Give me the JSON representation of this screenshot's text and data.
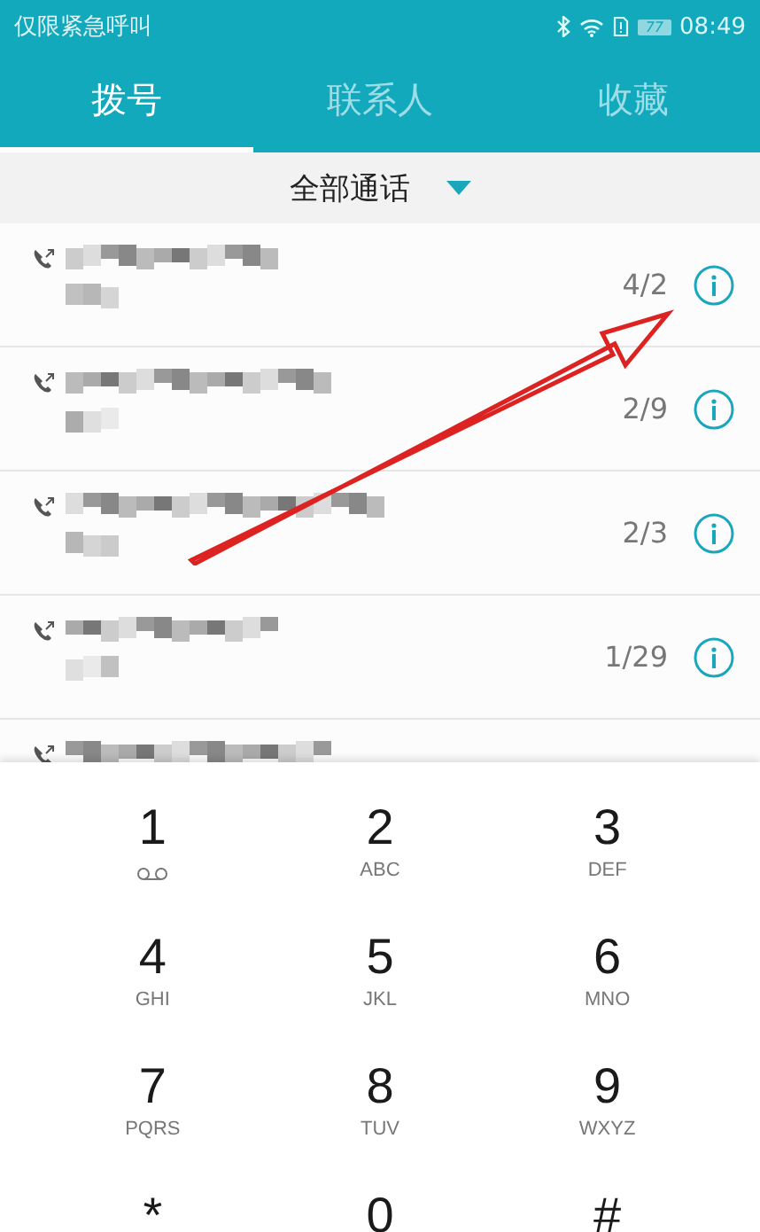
{
  "status_bar": {
    "carrier": "仅限紧急呼叫",
    "battery": "77",
    "time": "08:49"
  },
  "tabs": [
    {
      "label": "拨号",
      "selected": true
    },
    {
      "label": "联系人",
      "selected": false
    },
    {
      "label": "收藏",
      "selected": false
    }
  ],
  "filter": {
    "label": "全部通话"
  },
  "calls": [
    {
      "count": "4/2"
    },
    {
      "count": "2/9"
    },
    {
      "count": "2/3"
    },
    {
      "count": "1/29"
    },
    {
      "kind": "partial"
    }
  ],
  "keypad": [
    {
      "digit": "1",
      "kind": "voicemail"
    },
    {
      "digit": "2",
      "letters": "ABC"
    },
    {
      "digit": "3",
      "letters": "DEF"
    },
    {
      "digit": "4",
      "letters": "GHI"
    },
    {
      "digit": "5",
      "letters": "JKL"
    },
    {
      "digit": "6",
      "letters": "MNO"
    },
    {
      "digit": "7",
      "letters": "PQRS"
    },
    {
      "digit": "8",
      "letters": "TUV"
    },
    {
      "digit": "9",
      "letters": "WXYZ"
    },
    {
      "digit": "*"
    },
    {
      "digit": "0"
    },
    {
      "digit": "#"
    }
  ]
}
